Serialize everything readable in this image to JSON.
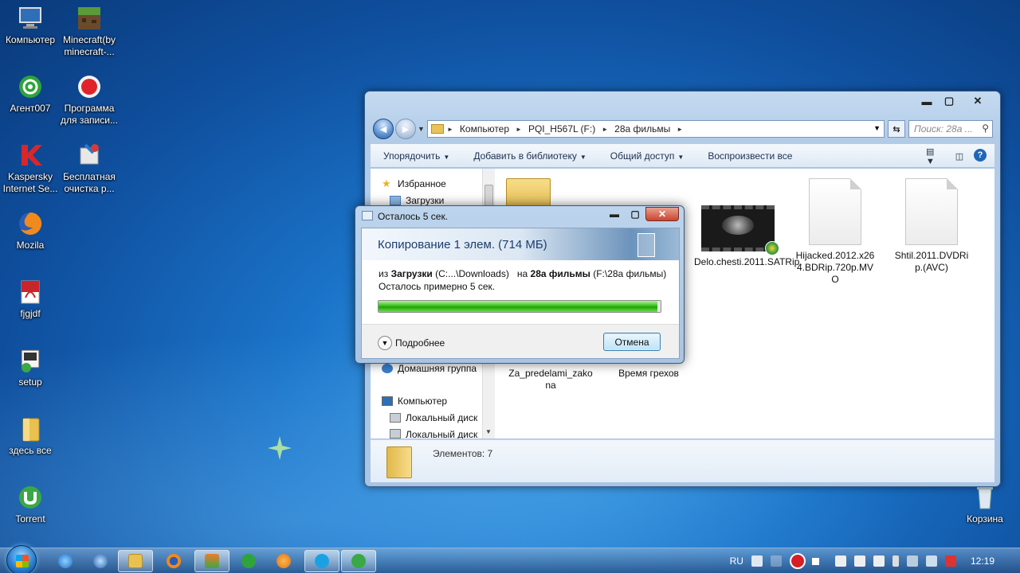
{
  "desktop": {
    "icons": [
      {
        "label": "Компьютер",
        "icon": "computer-icon"
      },
      {
        "label": "Minecraft(by minecraft-...",
        "icon": "minecraft-icon"
      },
      {
        "label": "Агент007",
        "icon": "agent-icon"
      },
      {
        "label": "Программа для записи...",
        "icon": "recorder-icon"
      },
      {
        "label": "Kaspersky Internet Se...",
        "icon": "kaspersky-icon"
      },
      {
        "label": "Бесплатная очистка р...",
        "icon": "cleaner-icon"
      },
      {
        "label": "Mozila",
        "icon": "firefox-icon"
      },
      {
        "label": "fjgjdf",
        "icon": "pdf-icon"
      },
      {
        "label": "setup",
        "icon": "setup-icon"
      },
      {
        "label": "здесь все",
        "icon": "folder-icon"
      },
      {
        "label": "Torrent",
        "icon": "utorrent-icon"
      },
      {
        "label": "Корзина",
        "icon": "recycle-bin-icon"
      }
    ]
  },
  "explorer": {
    "controls": {
      "minimize": "▬",
      "maximize": "▢",
      "close": "✕"
    },
    "address": {
      "crumbs": [
        "Компьютер",
        "PQI_H567L (F:)",
        "28а фильмы"
      ]
    },
    "search_placeholder": "Поиск: 28а ...",
    "toolbar": {
      "organize": "Упорядочить",
      "add_library": "Добавить в библиотеку",
      "share": "Общий доступ",
      "play_all": "Воспроизвести все"
    },
    "navpane": {
      "favorites": "Избранное",
      "downloads": "Загрузки",
      "homegroup": "Домашняя группа",
      "computer": "Компьютер",
      "local_disk_1": "Локальный диск",
      "local_disk_2": "Локальный диск"
    },
    "files": [
      {
        "name": "Delo.chesti.2011.SATRip.",
        "type": "video"
      },
      {
        "name": "Hijacked.2012.x264.BDRip.720p.MVO",
        "type": "document"
      },
      {
        "name": "Shtil.2011.DVDRip.(AVC)",
        "type": "document"
      },
      {
        "name": "Za_predelami_zakona",
        "type": "video"
      },
      {
        "name": "Время грехов",
        "type": "video"
      }
    ],
    "status": "Элементов: 7"
  },
  "copy_dialog": {
    "title": "Осталось 5 сек.",
    "heading": "Копирование 1 элем. (714 МБ)",
    "from_word": "из",
    "source_name": "Загрузки",
    "source_path": "(C:...\\Downloads)",
    "to_word": "на",
    "dest_name": "28а фильмы",
    "dest_path": "(F:\\28а фильмы)",
    "remaining": "Осталось примерно 5 сек.",
    "progress_fraction": 0.99,
    "more_label": "Подробнее",
    "cancel_label": "Отмена"
  },
  "taskbar": {
    "language": "RU",
    "time": "12:19"
  }
}
